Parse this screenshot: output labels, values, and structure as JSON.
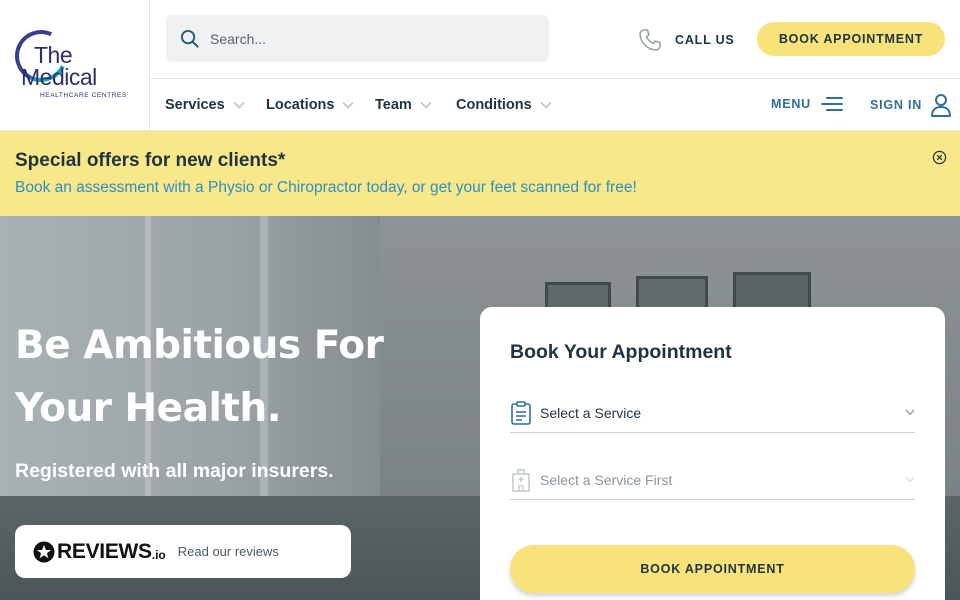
{
  "header": {
    "logo": {
      "line1": "The",
      "line2": "Medical",
      "tagline": "HEALTHCARE CENTRES"
    },
    "search": {
      "placeholder": "Search..."
    },
    "call_label": "CALL US",
    "book_label": "BOOK APPOINTMENT"
  },
  "nav": {
    "items": [
      {
        "label": "Services"
      },
      {
        "label": "Locations"
      },
      {
        "label": "Team"
      },
      {
        "label": "Conditions"
      }
    ],
    "menu_label": "MENU",
    "sign_in_label": "SIGN IN"
  },
  "offer": {
    "title": "Special offers for new clients*",
    "text": "Book an assessment with a Physio or Chiropractor today, or get your feet scanned for free!"
  },
  "hero": {
    "title": "Be Ambitious For Your Health.",
    "subtitle": "Registered with all major insurers."
  },
  "reviews": {
    "brand": "REVIEWS",
    "suffix": ".io",
    "link_label": "Read our reviews"
  },
  "booking": {
    "title": "Book Your Appointment",
    "service_select": "Select a Service",
    "location_select": "Select a Service First",
    "button_label": "BOOK APPOINTMENT"
  },
  "colors": {
    "accent_yellow": "#f7e37a",
    "banner_yellow": "#f8e88a",
    "link_blue": "#2d8fc2",
    "nav_blue": "#2f6f9a",
    "text_dark": "#1f3340"
  },
  "icons": {
    "search": "search-icon",
    "call": "phone-icon",
    "menu": "hamburger-icon",
    "sign_in": "user-icon",
    "close": "close-icon",
    "service": "clipboard-icon",
    "location": "building-icon",
    "reviews": "star-icon"
  }
}
